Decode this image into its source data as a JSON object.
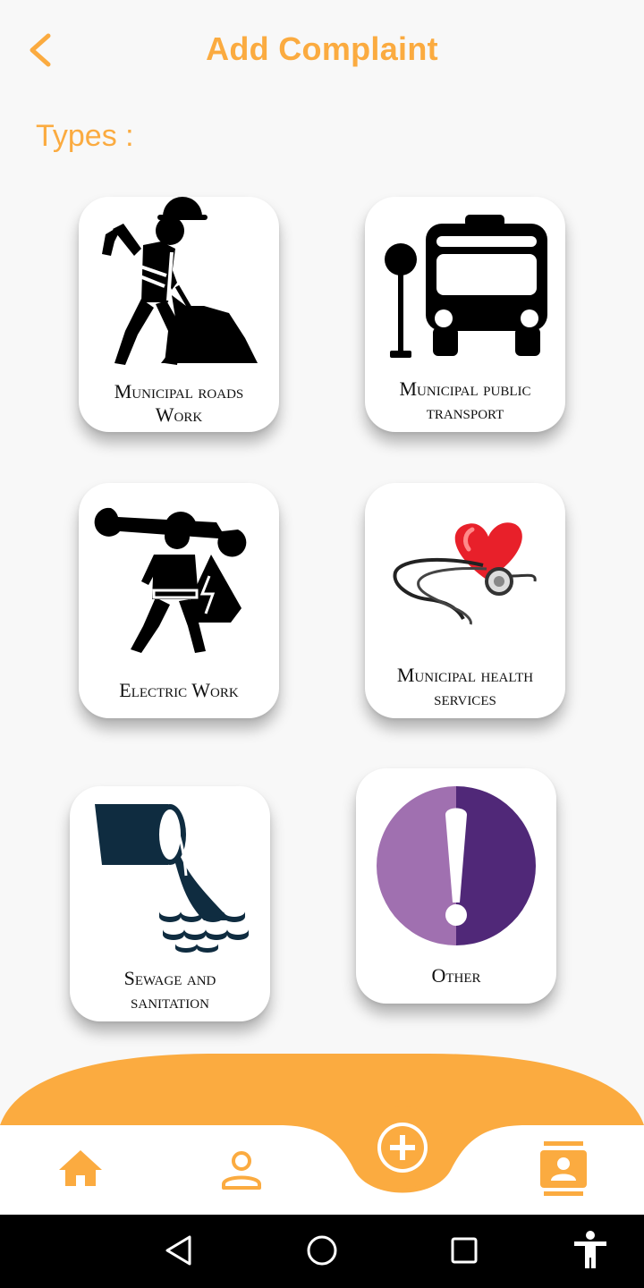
{
  "header": {
    "title": "Add Complaint",
    "back_icon": "chevron-left-icon"
  },
  "types_label": "Types :",
  "categories": [
    {
      "label_line1": "Municipal roads",
      "label_line2": "Work",
      "icon": "road-worker-icon"
    },
    {
      "label_line1": "Municipal public",
      "label_line2": "transport",
      "icon": "bus-stop-icon"
    },
    {
      "label_line1": "Electric Work",
      "label_line2": "",
      "icon": "electrician-icon"
    },
    {
      "label_line1": "Municipal health",
      "label_line2": "services",
      "icon": "heart-stethoscope-icon"
    },
    {
      "label_line1": "Sewage and",
      "label_line2": "sanitation",
      "icon": "sewage-pipe-icon"
    },
    {
      "label_line1": "Other",
      "label_line2": "",
      "icon": "exclamation-icon"
    }
  ],
  "bottom_nav": {
    "items": [
      {
        "icon": "home-icon"
      },
      {
        "icon": "person-icon"
      },
      {
        "icon": "add-circle-icon"
      },
      {
        "icon": "contact-card-icon"
      }
    ]
  },
  "system_bar": {
    "items": [
      "back-triangle-icon",
      "home-circle-icon",
      "recents-square-icon",
      "accessibility-icon"
    ]
  },
  "colors": {
    "accent": "#fbab40",
    "background": "#f8f8f8",
    "card": "#ffffff",
    "other_light_purple": "#a070b0",
    "other_dark_purple": "#502878",
    "sewage_navy": "#0f2c40",
    "heart_red": "#e8202a"
  }
}
